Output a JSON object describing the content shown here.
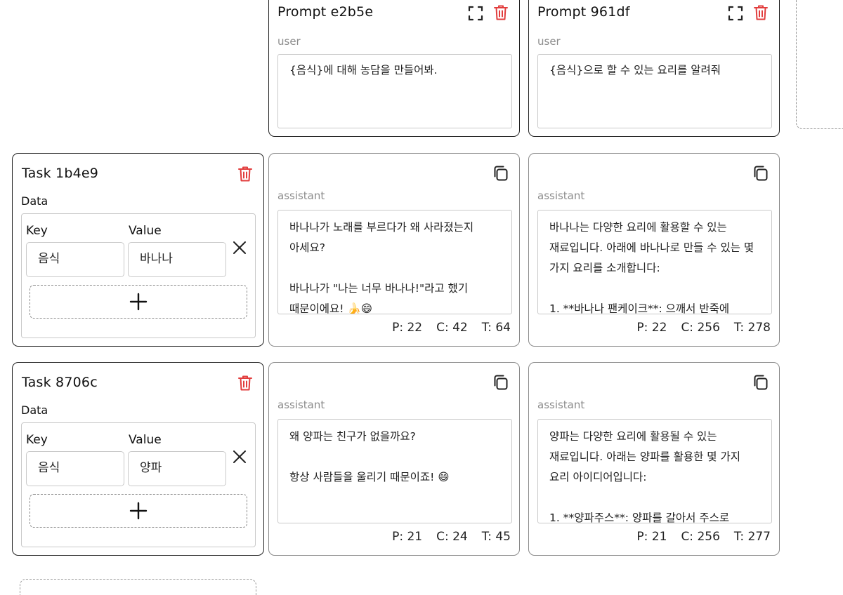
{
  "prompts": [
    {
      "title": "Prompt e2b5e",
      "role": "user",
      "text": "{음식}에 대해 농담을 만들어봐."
    },
    {
      "title": "Prompt 961df",
      "role": "user",
      "text": "{음식}으로 할 수 있는 요리를 알려줘"
    }
  ],
  "tasks": [
    {
      "title": "Task 1b4e9",
      "data_label": "Data",
      "key_header": "Key",
      "value_header": "Value",
      "key": "음식",
      "value": "바나나",
      "results": [
        {
          "role": "assistant",
          "text": "바나나가 노래를 부르다가 왜 사라졌는지 아세요?\n\n바나나가 \"나는 너무 바나나!\"라고 했기 때문이에요! 🍌😄",
          "p": "P: 22",
          "c": "C: 42",
          "t": "T: 64"
        },
        {
          "role": "assistant",
          "text": "바나나는 다양한 요리에 활용할 수 있는 재료입니다. 아래에 바나나로 만들 수 있는 몇 가지 요리를 소개합니다:\n\n1. **바나나 팬케이크**: 으깨서 반죽에",
          "p": "P: 22",
          "c": "C: 256",
          "t": "T: 278"
        }
      ]
    },
    {
      "title": "Task 8706c",
      "data_label": "Data",
      "key_header": "Key",
      "value_header": "Value",
      "key": "음식",
      "value": "양파",
      "results": [
        {
          "role": "assistant",
          "text": "왜 양파는 친구가 없을까요?\n\n항상 사람들을 울리기 때문이죠! 😄",
          "p": "P: 21",
          "c": "C: 24",
          "t": "T: 45"
        },
        {
          "role": "assistant",
          "text": "양파는 다양한 요리에 활용될 수 있는 재료입니다. 아래는 양파를 활용한 몇 가지 요리 아이디어입니다:\n\n1. **양파주스**: 양파를 갈아서 주스로",
          "p": "P: 21",
          "c": "C: 256",
          "t": "T: 277"
        }
      ]
    }
  ],
  "colors": {
    "danger": "#e23d3d",
    "border": "#222222",
    "muted": "#8c8c8c"
  },
  "icons": [
    "expand-icon",
    "trash-icon",
    "copy-icon",
    "close-icon",
    "plus-icon"
  ]
}
